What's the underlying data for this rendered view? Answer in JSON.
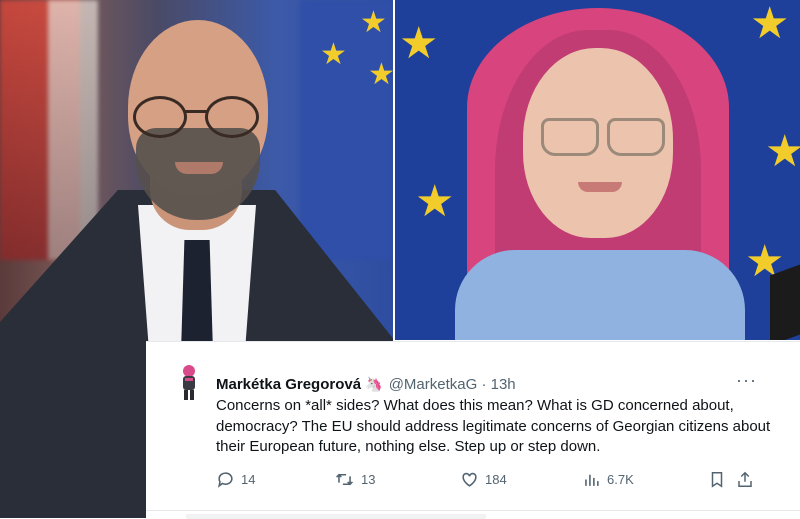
{
  "tweet": {
    "display_name": "Markétka Gregorová",
    "badge_emoji": "🦄",
    "handle": "@MarketkaG",
    "separator": "·",
    "time": "13h",
    "more_label": "···",
    "text": "Concerns on *all* sides? What does this mean? What is GD concerned about, democracy? The EU should address legitimate concerns of Georgian citizens about their European future, nothing else. Step up or step down.",
    "stats": {
      "replies": "14",
      "retweets": "13",
      "likes": "184",
      "views": "6.7K"
    }
  },
  "icons": {
    "reply": "reply-icon",
    "retweet": "retweet-icon",
    "like": "heart-icon",
    "views": "views-icon",
    "bookmark": "bookmark-icon",
    "share": "share-icon",
    "more": "more-icon"
  },
  "colors": {
    "eu_blue": "#1e3f9a",
    "eu_star": "#f2cc2a",
    "text_primary": "#0f1419",
    "text_secondary": "#536471",
    "hair_pink": "#d8457e"
  }
}
